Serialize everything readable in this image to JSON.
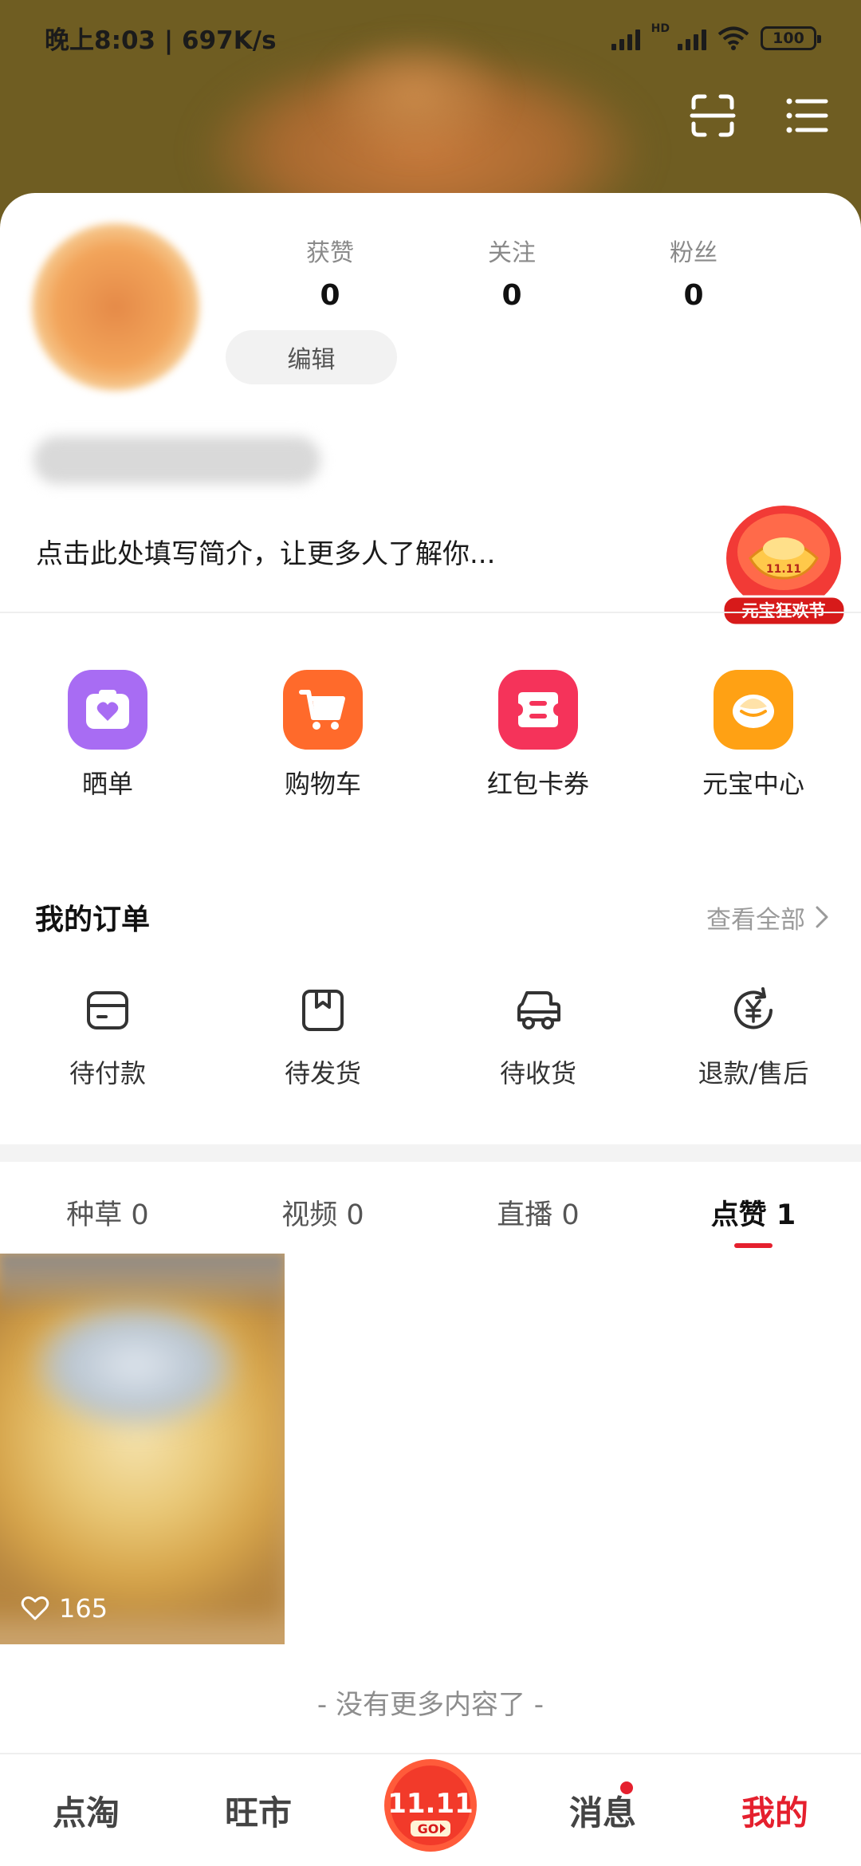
{
  "status_bar": {
    "time_speed": "晚上8:03 | 697K/s",
    "hd_label": "HD",
    "battery": "100"
  },
  "header": {
    "actions": [
      "scan-icon",
      "menu-icon"
    ]
  },
  "profile": {
    "stats": [
      {
        "label": "获赞",
        "value": "0"
      },
      {
        "label": "关注",
        "value": "0"
      },
      {
        "label": "粉丝",
        "value": "0"
      }
    ],
    "edit_label": "编辑",
    "bio": "点击此处填写简介，让更多人了解你...",
    "festival_badge": {
      "top_text": "11.11",
      "label": "元宝狂欢节"
    }
  },
  "tools": [
    {
      "label": "晒单",
      "icon": "showcase-icon",
      "color": "#a86cf3"
    },
    {
      "label": "购物车",
      "icon": "cart-icon",
      "color": "#ff6a2b"
    },
    {
      "label": "红包卡券",
      "icon": "coupon-icon",
      "color": "#f5335a"
    },
    {
      "label": "元宝中心",
      "icon": "ingot-icon",
      "color": "#ffa114"
    }
  ],
  "orders": {
    "title": "我的订单",
    "view_all": "查看全部",
    "items": [
      {
        "label": "待付款",
        "icon": "wallet-icon"
      },
      {
        "label": "待发货",
        "icon": "package-icon"
      },
      {
        "label": "待收货",
        "icon": "truck-icon"
      },
      {
        "label": "退款/售后",
        "icon": "refund-icon"
      }
    ]
  },
  "content_tabs": [
    {
      "label": "种草 0",
      "active": false
    },
    {
      "label": "视频 0",
      "active": false
    },
    {
      "label": "直播 0",
      "active": false
    },
    {
      "label": "点赞 1",
      "active": true
    }
  ],
  "posts": [
    {
      "likes": "165"
    }
  ],
  "end_text": "- 没有更多内容了 -",
  "bottom_nav": {
    "items": [
      {
        "label": "点淘",
        "active": false
      },
      {
        "label": "旺市",
        "active": false
      },
      {
        "label": "",
        "active": false
      },
      {
        "label": "消息",
        "active": false
      },
      {
        "label": "我的",
        "active": true
      }
    ],
    "center_text": "11.11",
    "center_sub": "GO"
  },
  "colors": {
    "accent": "#e5202e",
    "header_bg": "#6f5d22"
  }
}
